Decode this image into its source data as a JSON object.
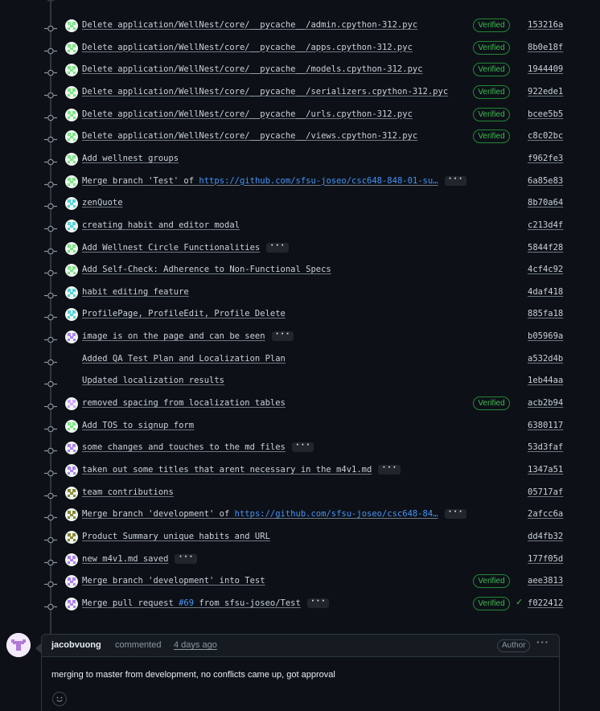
{
  "commits": [
    {
      "message": "Delete application/WellNest/core/__pycache__/admin.cpython-312.pyc",
      "link": "",
      "avatar": "green",
      "verified": true,
      "sha": "153216a",
      "more": false,
      "check": false
    },
    {
      "message": "Delete application/WellNest/core/__pycache__/apps.cpython-312.pyc",
      "link": "",
      "avatar": "green",
      "verified": true,
      "sha": "8b0e18f",
      "more": false,
      "check": false
    },
    {
      "message": "Delete application/WellNest/core/__pycache__/models.cpython-312.pyc",
      "link": "",
      "avatar": "green",
      "verified": true,
      "sha": "1944409",
      "more": false,
      "check": false
    },
    {
      "message": "Delete application/WellNest/core/__pycache__/serializers.cpython-312.pyc",
      "link": "",
      "avatar": "green",
      "verified": true,
      "sha": "922ede1",
      "more": false,
      "check": false
    },
    {
      "message": "Delete application/WellNest/core/__pycache__/urls.cpython-312.pyc",
      "link": "",
      "avatar": "green",
      "verified": true,
      "sha": "bcee5b5",
      "more": false,
      "check": false
    },
    {
      "message": "Delete application/WellNest/core/__pycache__/views.cpython-312.pyc",
      "link": "",
      "avatar": "green",
      "verified": true,
      "sha": "c8c02bc",
      "more": false,
      "check": false
    },
    {
      "message": "Add wellnest groups",
      "link": "",
      "avatar": "green",
      "verified": false,
      "sha": "f962fe3",
      "more": false,
      "check": false
    },
    {
      "message": "Merge branch 'Test' of ",
      "link": "https://github.com/sfsu-joseo/csc648-848-01-su…",
      "avatar": "green",
      "verified": false,
      "sha": "6a85e83",
      "more": true,
      "check": false
    },
    {
      "message": "zenQuote",
      "link": "",
      "avatar": "teal",
      "verified": false,
      "sha": "8b70a64",
      "more": false,
      "check": false
    },
    {
      "message": "creating habit and editor modal",
      "link": "",
      "avatar": "teal",
      "verified": false,
      "sha": "c213d4f",
      "more": false,
      "check": false
    },
    {
      "message": "Add Wellnest Circle Functionalities",
      "link": "",
      "avatar": "green",
      "verified": false,
      "sha": "5844f28",
      "more": true,
      "check": false
    },
    {
      "message": "Add Self-Check: Adherence to Non-Functional Specs",
      "link": "",
      "avatar": "green",
      "verified": false,
      "sha": "4cf4c92",
      "more": false,
      "check": false
    },
    {
      "message": "habit editing feature",
      "link": "",
      "avatar": "teal",
      "verified": false,
      "sha": "4daf418",
      "more": false,
      "check": false
    },
    {
      "message": "ProfilePage, ProfileEdit, Profile Delete",
      "link": "",
      "avatar": "teal",
      "verified": false,
      "sha": "885fa18",
      "more": false,
      "check": false
    },
    {
      "message": "image is on the page and can be seen",
      "link": "",
      "avatar": "purple",
      "verified": false,
      "sha": "b05969a",
      "more": true,
      "check": false
    },
    {
      "message": "Added QA Test Plan and Localization Plan",
      "link": "",
      "avatar": "none",
      "verified": false,
      "sha": "a532d4b",
      "more": false,
      "check": false
    },
    {
      "message": "Updated localization results",
      "link": "",
      "avatar": "none",
      "verified": false,
      "sha": "1eb44aa",
      "more": false,
      "check": false
    },
    {
      "message": "removed spacing from localization tables",
      "link": "",
      "avatar": "pink",
      "verified": true,
      "sha": "acb2b94",
      "more": false,
      "check": false
    },
    {
      "message": "Add TOS to signup form",
      "link": "",
      "avatar": "green",
      "verified": false,
      "sha": "6380117",
      "more": false,
      "check": false
    },
    {
      "message": "some changes and touches to the md files",
      "link": "",
      "avatar": "purple",
      "verified": false,
      "sha": "53d3faf",
      "more": true,
      "check": false
    },
    {
      "message": "taken out some titles that arent necessary in the m4v1.md",
      "link": "",
      "avatar": "purple",
      "verified": false,
      "sha": "1347a51",
      "more": true,
      "check": false
    },
    {
      "message": "team contributions",
      "link": "",
      "avatar": "olive",
      "verified": false,
      "sha": "05717af",
      "more": false,
      "check": false
    },
    {
      "message": "Merge branch 'development' of ",
      "link": "https://github.com/sfsu-joseo/csc648-84…",
      "avatar": "olive",
      "verified": false,
      "sha": "2afcc6a",
      "more": true,
      "check": false
    },
    {
      "message": "Product Summary unique habits and URL",
      "link": "",
      "avatar": "olive",
      "verified": false,
      "sha": "dd4fb32",
      "more": false,
      "check": false
    },
    {
      "message": "new m4v1.md saved",
      "link": "",
      "avatar": "purple",
      "verified": false,
      "sha": "177f05d",
      "more": true,
      "check": false
    },
    {
      "message": "Merge branch 'development' into Test",
      "link": "",
      "avatar": "purple",
      "verified": true,
      "sha": "aee3813",
      "more": false,
      "check": false
    },
    {
      "message": "Merge pull request ",
      "link": "#69",
      "suffix": " from sfsu-joseo/Test",
      "avatar": "purple",
      "verified": true,
      "sha": "f022412",
      "more": true,
      "check": true
    }
  ],
  "labels": {
    "verified": "Verified",
    "more": "···",
    "check": "✓"
  },
  "comment": {
    "author": "jacobvuong",
    "verb": "commented",
    "time": "4 days ago",
    "badge": "Author",
    "kebab": "···",
    "body": "merging to master from development, no conflicts came up, got approval",
    "emoji": "☺"
  },
  "colors": {
    "green": "#7ee787",
    "teal": "#56d4dd",
    "purple": "#b083f0",
    "pink": "#d2a8ff",
    "olive": "#8a8a3a",
    "verified_text": "#3fb950",
    "link": "#4493f8"
  }
}
